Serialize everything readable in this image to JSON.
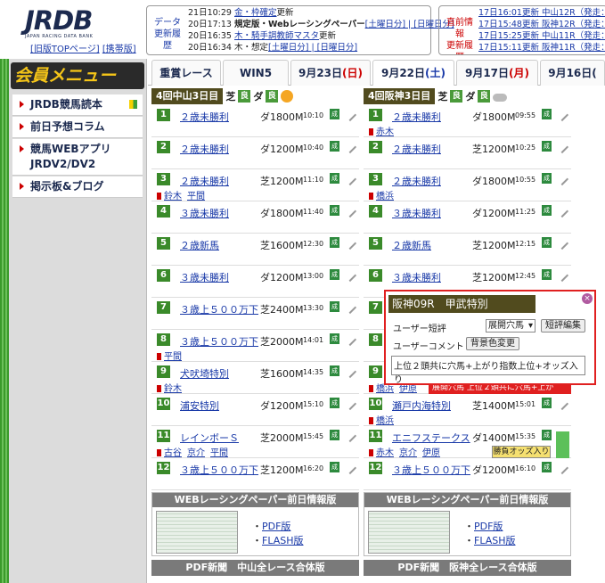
{
  "header": {
    "logo_text": "JRDB",
    "logo_sub": "JAPAN RACING DATA BANK",
    "old_top_link": "[旧版TOPページ]",
    "mobile_link": "[携帯版]"
  },
  "update_history": {
    "label_line1": "データ",
    "label_line2": "更新履歴",
    "items": [
      {
        "time": "21日10:29",
        "text": "金・枠確定",
        "suffix": "更新"
      },
      {
        "time": "20日17:13",
        "text": "規定版・Webレーシングペーパー",
        "links": "[土曜日分] | [日曜日分]"
      },
      {
        "time": "20日16:35",
        "text": "木・騎手調教師マスタ",
        "suffix": "更新"
      },
      {
        "time": "20日16:34",
        "text": "木・想定",
        "links": "[土曜日分] | [日曜日分]"
      }
    ]
  },
  "latest_info": {
    "label_line1": "直前情報",
    "label_line2": "更新履歴",
    "items": [
      "17日16:01更新 中山12R（発走：16",
      "17日15:48更新 阪神12R（発走：16",
      "17日15:25更新 中山11R（発走：15",
      "17日15:11更新 阪神11R（発走：15"
    ]
  },
  "sidebar": {
    "member_menu": "会員メニュー",
    "items": [
      {
        "label": "JRDB競馬読本"
      },
      {
        "label": "前日予想コラム"
      },
      {
        "label": "競馬WEBアプリ JRDV2/DV2"
      },
      {
        "label": "掲示板&ブログ"
      }
    ]
  },
  "tabs": [
    {
      "label": "重賞レース"
    },
    {
      "label": "WIN5"
    },
    {
      "label": "9月23日",
      "day": "(日)"
    },
    {
      "label": "9月22日",
      "day": "(土)"
    },
    {
      "label": "9月17日",
      "day": "(月)"
    },
    {
      "label": "9月16日",
      "day": "("
    }
  ],
  "left_venue": {
    "name": "4回中山3日目",
    "turf": "芝",
    "turf_cond": "良",
    "dirt": "ダ",
    "dirt_cond": "良",
    "weather": "sun-icon",
    "races": [
      {
        "no": "1",
        "name": "２歳未勝利",
        "dist": "ダ1800M",
        "time": "10:10",
        "jockeys": []
      },
      {
        "no": "2",
        "name": "２歳未勝利",
        "dist": "ダ1200M",
        "time": "10:40",
        "jockeys": []
      },
      {
        "no": "3",
        "name": "２歳未勝利",
        "dist": "芝1200M",
        "time": "11:10",
        "jockeys": [
          "鈴木",
          "平間"
        ]
      },
      {
        "no": "4",
        "name": "３歳未勝利",
        "dist": "ダ1800M",
        "time": "11:40",
        "jockeys": []
      },
      {
        "no": "5",
        "name": "２歳新馬",
        "dist": "芝1600M",
        "time": "12:30",
        "jockeys": []
      },
      {
        "no": "6",
        "name": "３歳未勝利",
        "dist": "ダ1200M",
        "time": "13:00",
        "jockeys": []
      },
      {
        "no": "7",
        "name": "３歳上５００万下",
        "dist": "芝2400M",
        "time": "13:30",
        "jockeys": []
      },
      {
        "no": "8",
        "name": "３歳上５００万下",
        "dist": "芝2000M",
        "time": "14:01",
        "jockeys": [
          "平間"
        ]
      },
      {
        "no": "9",
        "name": "犬吠埼特別",
        "dist": "芝1600M",
        "time": "14:35",
        "jockeys": [
          "鈴木"
        ]
      },
      {
        "no": "10",
        "name": "浦安特別",
        "dist": "ダ1200M",
        "time": "15:10",
        "jockeys": []
      },
      {
        "no": "11",
        "name": "レインボーＳ",
        "dist": "芝2000M",
        "time": "15:45",
        "jockeys": [
          "古谷",
          "京介",
          "平間"
        ]
      },
      {
        "no": "12",
        "name": "３歳上５００万下",
        "dist": "芝1200M",
        "time": "16:20",
        "jockeys": []
      }
    ]
  },
  "right_venue": {
    "name": "4回阪神3日目",
    "turf": "芝",
    "turf_cond": "良",
    "dirt": "ダ",
    "dirt_cond": "良",
    "weather": "cloud-icon",
    "races": [
      {
        "no": "1",
        "name": "２歳未勝利",
        "dist": "ダ1800M",
        "time": "09:55",
        "jockeys": [
          "赤木"
        ]
      },
      {
        "no": "2",
        "name": "２歳未勝利",
        "dist": "芝1200M",
        "time": "10:25",
        "jockeys": []
      },
      {
        "no": "3",
        "name": "２歳未勝利",
        "dist": "ダ1800M",
        "time": "10:55",
        "jockeys": [
          "橋浜"
        ]
      },
      {
        "no": "4",
        "name": "３歳未勝利",
        "dist": "ダ1200M",
        "time": "11:25",
        "jockeys": []
      },
      {
        "no": "5",
        "name": "２歳新馬",
        "dist": "芝1200M",
        "time": "12:15",
        "jockeys": []
      },
      {
        "no": "6",
        "name": "３歳未勝利",
        "dist": "芝1200M",
        "time": "12:45",
        "jockeys": []
      },
      {
        "no": "7",
        "name": "",
        "dist": "",
        "time": "",
        "jockeys": []
      },
      {
        "no": "8",
        "name": "",
        "dist": "",
        "time": "",
        "jockeys": []
      },
      {
        "no": "9",
        "name": "",
        "dist": "",
        "time": "",
        "jockeys": [
          "橋浜",
          "伊原"
        ]
      },
      {
        "no": "10",
        "name": "瀬戸内海特別",
        "dist": "芝1400M",
        "time": "15:01",
        "jockeys": [
          "橋浜"
        ]
      },
      {
        "no": "11",
        "name": "エニフステークス",
        "dist": "ダ1400M",
        "time": "15:35",
        "jockeys": [
          "赤木",
          "京介",
          "伊原"
        ]
      },
      {
        "no": "12",
        "name": "３歳上５００万下",
        "dist": "ダ1200M",
        "time": "16:10",
        "jockeys": []
      }
    ]
  },
  "highlight_row": "展開穴馬 上位２頭共に穴馬+上が",
  "odds_button": "勝負オッズ入り",
  "seiseki": "成",
  "popup": {
    "title": "阪神09R　甲武特別",
    "close": "×",
    "short_label": "ユーザー短評",
    "short_value": "展開穴馬",
    "edit_button": "短評編集",
    "comment_label": "ユーザーコメント",
    "bg_button": "背景色変更",
    "comment_text": "上位２頭共に穴馬+上がり指数上位+オッズ入り"
  },
  "webpaper_left": {
    "title": "WEBレーシングペーパー前日情報版",
    "pdf": "PDF版",
    "flash": "FLASH版",
    "pdf_bar": "PDF新聞　中山全レース合体版"
  },
  "webpaper_right": {
    "title": "WEBレーシングペーパー前日情報版",
    "pdf": "PDF版",
    "flash": "FLASH版",
    "pdf_bar": "PDF新聞　阪神全レース合体版"
  },
  "colors": {
    "venue_bg": "#514b1e",
    "race_no_bg": "#3a8a2a",
    "highlight": "#e02020"
  }
}
